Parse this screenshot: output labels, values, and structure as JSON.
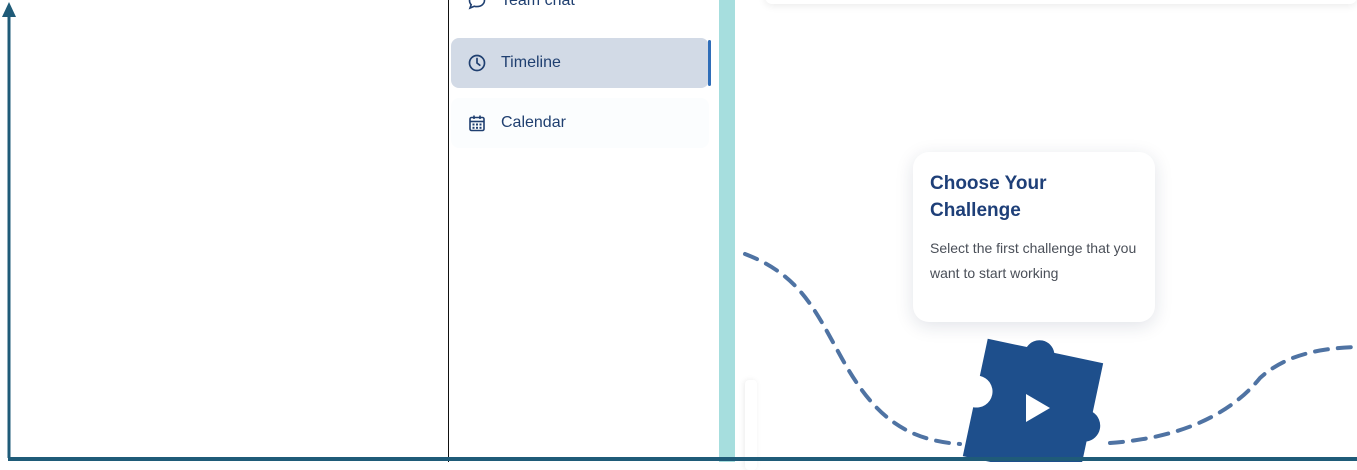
{
  "sidebar": {
    "items": [
      {
        "label": "Team chat",
        "icon": "chat-bubble-icon",
        "active": false
      },
      {
        "label": "Timeline",
        "icon": "clock-icon",
        "active": true
      },
      {
        "label": "Calendar",
        "icon": "calendar-icon",
        "active": false
      }
    ]
  },
  "challenge_card": {
    "title": "Choose Your Challenge",
    "description": "Select the first challenge that you want to start working"
  },
  "play_button": {
    "icon": "play-icon"
  },
  "colors": {
    "accent_blue": "#1e4f8c",
    "active_bg": "#d2dae6",
    "divider_teal": "#a6dede",
    "title_blue": "#1e3f78"
  }
}
